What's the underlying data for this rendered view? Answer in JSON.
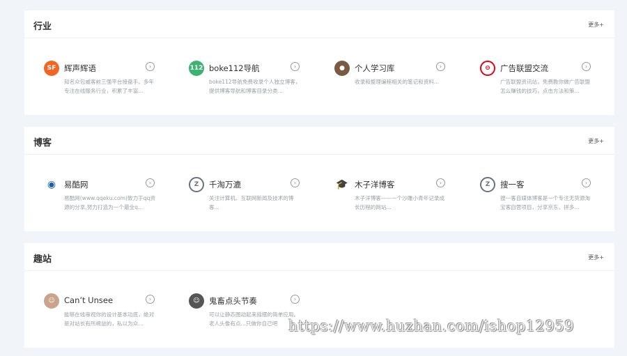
{
  "sections": [
    {
      "title": "行业",
      "more": "更多+",
      "items": [
        {
          "name": "辉声辉语",
          "desc": "知名众包威客前三强平台接盘手。多年专注在线服务行业，积累了丰富...",
          "icon": "sf-logo-icon",
          "color": "#f26522"
        },
        {
          "name": "boke112导航",
          "desc": "boke112导航免费收录个人独立博客，提供博客导航和博客目录分类...",
          "icon": "badge-112-icon",
          "color": "#3cb371"
        },
        {
          "name": "个人学习库",
          "desc": "收录和整理编程相关的笔记和资料...",
          "icon": "avatar-icon",
          "color": "#7a5a40"
        },
        {
          "name": "广告联盟交流",
          "desc": "广告联盟资讯站，免费教你做广告联盟怎么赚钱的技巧，点击方法和策...",
          "icon": "ad-union-logo-icon",
          "color": "#e60012"
        }
      ]
    },
    {
      "title": "博客",
      "more": "更多+",
      "items": [
        {
          "name": "易酷网",
          "desc": "易酷网(www.qqeku.com)致力于qq资源的分享,努力打造为一个最全q...",
          "icon": "globe-logo-icon",
          "color": "#1a5fa8"
        },
        {
          "name": "千淘万漉",
          "desc": "关注计算机、互联网新闻及技术的博客...",
          "icon": "z-logo-icon",
          "color": "#6a7280"
        },
        {
          "name": "木子洋博客",
          "desc": "木子洋博客——一个沙雕小青年记录成长历程的网站...",
          "icon": "graduation-cap-icon",
          "color": "#1ea1e6"
        },
        {
          "name": "搜一客",
          "desc": "搜一客自媒体博客是一个专注无货源淘宝客自营项目，分享京东、拼多...",
          "icon": "z-logo-icon",
          "color": "#6a7280"
        }
      ]
    },
    {
      "title": "趣站",
      "more": "更多+",
      "items": [
        {
          "name": "Can’t Unsee",
          "desc": "能够在线审视你的设计基本功底，绝对是对站长有所裨益的，私以为众...",
          "icon": "person-avatar-icon",
          "color": "#c9a38a"
        },
        {
          "name": "鬼畜点头节奏",
          "desc": "可以让静态图动起来摇摆的简单应用。老人头像有点...只做你自己吧",
          "icon": "old-man-avatar-icon",
          "color": "#555555"
        }
      ]
    }
  ],
  "watermark": "https://www.huzhan.com/ishop12959"
}
